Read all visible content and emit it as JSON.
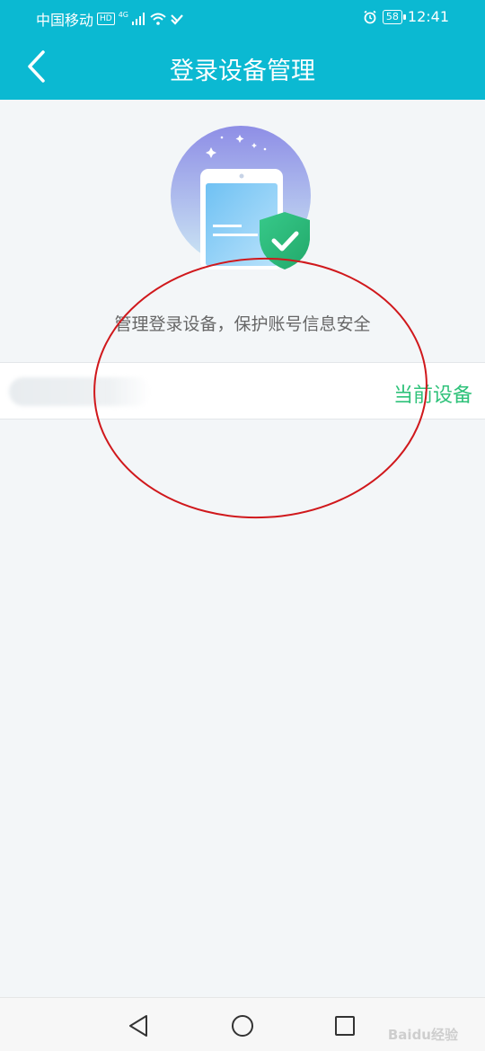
{
  "status_bar": {
    "carrier": "中国移动",
    "hd_badge": "HD",
    "network_type": "4G",
    "battery_level": "58",
    "time": "12:41"
  },
  "header": {
    "title": "登录设备管理"
  },
  "main": {
    "subtitle": "管理登录设备，保护账号信息安全",
    "devices": [
      {
        "name": "",
        "status": "当前设备"
      }
    ]
  },
  "watermark": "Baidu经验",
  "colors": {
    "brand": "#0bb9d2",
    "current_device": "#2fc27a",
    "annotation": "#d0181c"
  }
}
